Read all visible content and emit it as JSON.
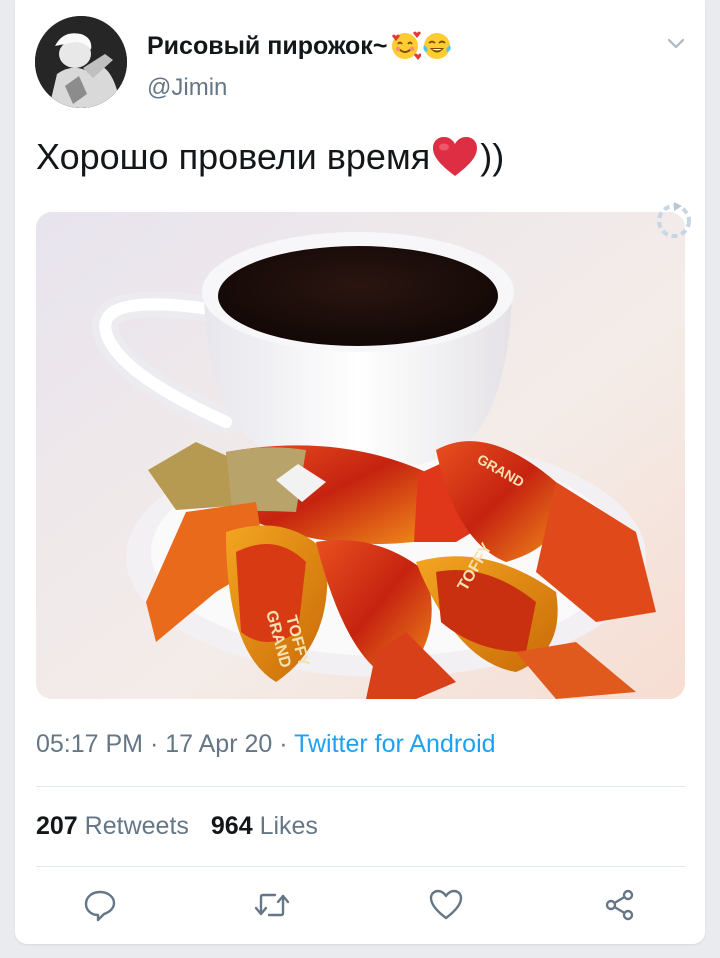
{
  "tweet": {
    "display_name": "Рисовый пирожок~",
    "handle": "@Jimin",
    "text_main": "Хорошо провели время",
    "text_tail": "))",
    "time": "05:17 PM",
    "date": "17 Apr 20",
    "source": "Twitter for Android",
    "retweets_count": "207",
    "retweets_label": "Retweets",
    "likes_count": "964",
    "likes_label": "Likes"
  },
  "media_text": {
    "candy_brand_1": "GRAND",
    "candy_brand_2": "TOFFY",
    "candy_brand_3": "GRAND",
    "candy_brand_4": "TOFFY"
  },
  "icons": {
    "name_emoji_1": "smiling-face-with-hearts-icon",
    "name_emoji_2": "face-with-tears-of-joy-icon",
    "text_emoji": "red-heart-icon",
    "chevron": "chevron-down-icon",
    "media_overlay": "refresh-icon",
    "reply": "reply-icon",
    "retweet": "retweet-icon",
    "like": "heart-outline-icon",
    "share": "share-icon"
  },
  "colors": {
    "accent": "#1da1f2",
    "secondary_text": "#657786",
    "primary_text": "#14171a",
    "divider": "#e1e8ed"
  }
}
